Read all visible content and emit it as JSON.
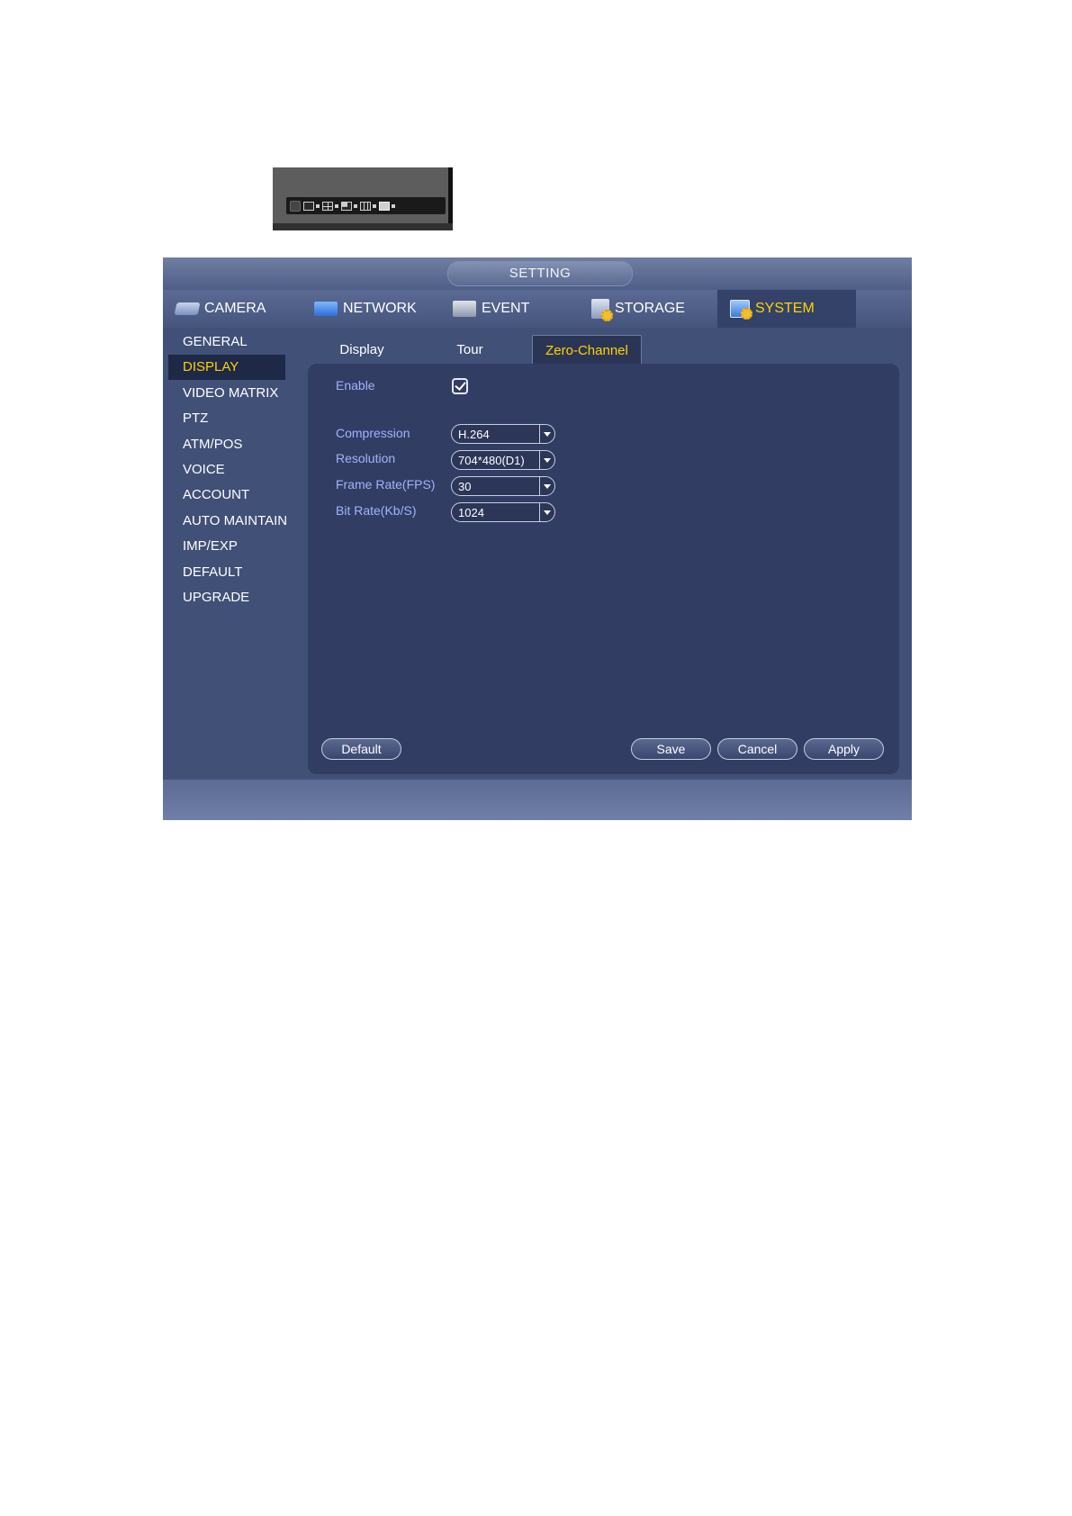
{
  "window": {
    "title": "SETTING"
  },
  "main_tabs": [
    {
      "label": "CAMERA",
      "icon": "camera-icon"
    },
    {
      "label": "NETWORK",
      "icon": "network-icon"
    },
    {
      "label": "EVENT",
      "icon": "event-icon"
    },
    {
      "label": "STORAGE",
      "icon": "storage-icon"
    },
    {
      "label": "SYSTEM",
      "icon": "system-icon",
      "active": true
    }
  ],
  "sidebar": {
    "items": [
      {
        "label": "GENERAL"
      },
      {
        "label": "DISPLAY",
        "active": true
      },
      {
        "label": "VIDEO MATRIX"
      },
      {
        "label": "PTZ"
      },
      {
        "label": "ATM/POS"
      },
      {
        "label": "VOICE"
      },
      {
        "label": "ACCOUNT"
      },
      {
        "label": "AUTO MAINTAIN"
      },
      {
        "label": "IMP/EXP"
      },
      {
        "label": "DEFAULT"
      },
      {
        "label": "UPGRADE"
      }
    ]
  },
  "sub_tabs": [
    {
      "label": "Display"
    },
    {
      "label": "Tour"
    },
    {
      "label": "Zero-Channel",
      "active": true
    }
  ],
  "form": {
    "enable": {
      "label": "Enable",
      "checked": true
    },
    "compression": {
      "label": "Compression",
      "value": "H.264"
    },
    "resolution": {
      "label": "Resolution",
      "value": "704*480(D1)"
    },
    "frame_rate": {
      "label": "Frame Rate(FPS)",
      "value": "30"
    },
    "bit_rate": {
      "label": "Bit Rate(Kb/S)",
      "value": "1024"
    }
  },
  "buttons": {
    "default": "Default",
    "save": "Save",
    "cancel": "Cancel",
    "apply": "Apply"
  },
  "colors": {
    "accent_active": "#ffd200",
    "label_blue": "#9fb4ff",
    "panel_bg": "#313d62",
    "window_bg": "#405077"
  },
  "toolbar_snippet": {
    "icons": [
      "window-split-1-icon",
      "window-split-4-icon",
      "window-split-8-icon",
      "window-split-9-icon",
      "window-split-16-icon"
    ]
  }
}
